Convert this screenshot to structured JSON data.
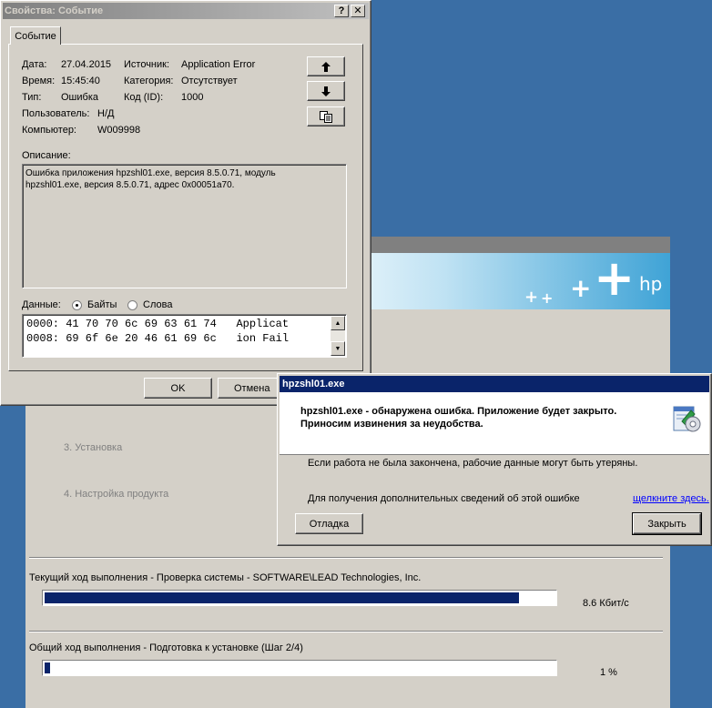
{
  "colors": {
    "desktop": "#3a6ea5",
    "window_face": "#d4d0c8",
    "active_title": "#0a246a",
    "inactive_title": "#808080",
    "progress": "#0a246a",
    "link": "#0000ff"
  },
  "installer": {
    "logo_text": "hp",
    "steps": [
      {
        "label": "3.  Установка"
      },
      {
        "label": "4.  Настройка продукта"
      }
    ],
    "current_progress": {
      "label": "Текущий ход выполнения - Проверка системы - SOFTWARE\\LEAD Technologies, Inc.",
      "fraction": 0.93,
      "rate": "8.6 Кбит/с"
    },
    "overall_progress": {
      "label": "Общий ход выполнения - Подготовка к установке (Шаг 2/4)",
      "fraction": 0.01,
      "percent": "1 %"
    }
  },
  "event_dialog": {
    "title": "Свойства: Событие",
    "help_button": "?",
    "close_button": "✕",
    "tab_label": "Событие",
    "fields": {
      "date_label": "Дата:",
      "date_value": "27.04.2015",
      "time_label": "Время:",
      "time_value": "15:45:40",
      "type_label": "Тип:",
      "type_value": "Ошибка",
      "user_label": "Пользователь:",
      "user_value": "Н/Д",
      "computer_label": "Компьютер:",
      "computer_value": "W009998",
      "source_label": "Источник:",
      "source_value": "Application Error",
      "category_label": "Категория:",
      "category_value": "Отсутствует",
      "code_label": "Код (ID):",
      "code_value": "1000"
    },
    "description_label": "Описание:",
    "description_lines": [
      "Ошибка приложения hpzshl01.exe, версия 8.5.0.71, модуль",
      "hpzshl01.exe, версия 8.5.0.71, адрес 0x00051a70."
    ],
    "data_label": "Данные:",
    "data_format_bytes": "Байты",
    "data_format_words": "Слова",
    "data_format_selected": "bytes",
    "data_rows": [
      "0000: 41 70 70 6c 69 63 61 74   Applicat",
      "0008: 69 6f 6e 20 46 61 69 6c   ion Fail"
    ],
    "ok_button": "OK",
    "cancel_button": "Отмена"
  },
  "error_dialog": {
    "title": "hpzshl01.exe",
    "headline_line1": "hpzshl01.exe - обнаружена ошибка. Приложение будет закрыто.",
    "headline_line2": "Приносим извинения за неудобства.",
    "message": "Если работа не была закончена, рабочие данные могут быть утеряны.",
    "details_text": "Для получения дополнительных сведений об этой ошибке",
    "details_link": "щелкните здесь.",
    "debug_button": "Отладка",
    "close_button": "Закрыть"
  }
}
